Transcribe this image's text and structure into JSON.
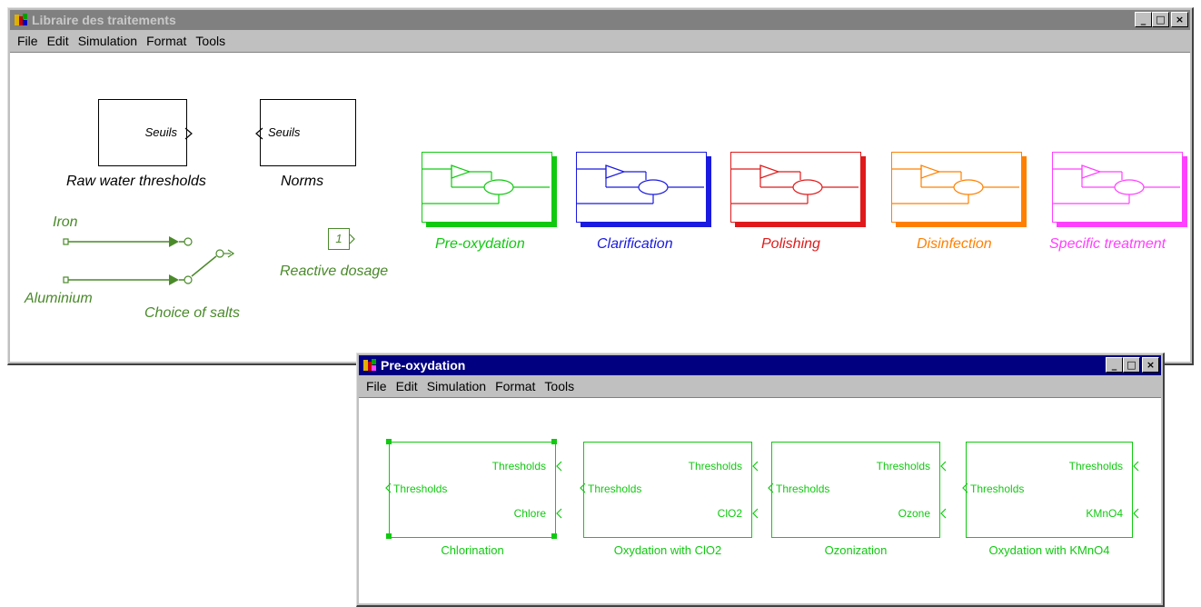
{
  "main_window": {
    "title": "Libraire des traitements",
    "menu": [
      "File",
      "Edit",
      "Simulation",
      "Format",
      "Tools"
    ],
    "blocks": {
      "raw_water": {
        "port_label": "Seuils",
        "caption": "Raw water thresholds"
      },
      "norms": {
        "port_label": "Seuils",
        "caption": "Norms"
      },
      "iron_label": "Iron",
      "aluminium_label": "Aluminium",
      "choice_label": "Choice of salts",
      "reactive": {
        "value": "1",
        "caption": "Reactive dosage"
      }
    },
    "treatments": [
      {
        "label": "Pre-oxydation",
        "color": "#11c911",
        "shadow": "#11c911"
      },
      {
        "label": "Clarification",
        "color": "#1a1ae0",
        "shadow": "#1a1ae0"
      },
      {
        "label": "Polishing",
        "color": "#e01a1a",
        "shadow": "#e01a1a"
      },
      {
        "label": "Disinfection",
        "color": "#ff8000",
        "shadow": "#ff8000"
      },
      {
        "label": "Specific treatment",
        "color": "#ff40ff",
        "shadow": "#ff40ff"
      }
    ],
    "colors": {
      "inactive_title": "#808080",
      "signal_green": "#4a8a2a"
    }
  },
  "sub_window": {
    "title": "Pre-oxydation",
    "menu": [
      "File",
      "Edit",
      "Simulation",
      "Format",
      "Tools"
    ],
    "blocks": [
      {
        "in_label": "Thresholds",
        "out1": "Thresholds",
        "out2": "Chlore",
        "caption": "Chlorination"
      },
      {
        "in_label": "Thresholds",
        "out1": "Thresholds",
        "out2": "ClO2",
        "caption": "Oxydation with ClO2"
      },
      {
        "in_label": "Thresholds",
        "out1": "Thresholds",
        "out2": "Ozone",
        "caption": "Ozonization"
      },
      {
        "in_label": "Thresholds",
        "out1": "Thresholds",
        "out2": "KMnO4",
        "caption": "Oxydation with KMnO4"
      }
    ],
    "colors": {
      "active_title": "#000080",
      "block_green": "#11c911"
    }
  },
  "window_buttons": {
    "minimize": "_",
    "maximize": "□",
    "close": "×"
  }
}
